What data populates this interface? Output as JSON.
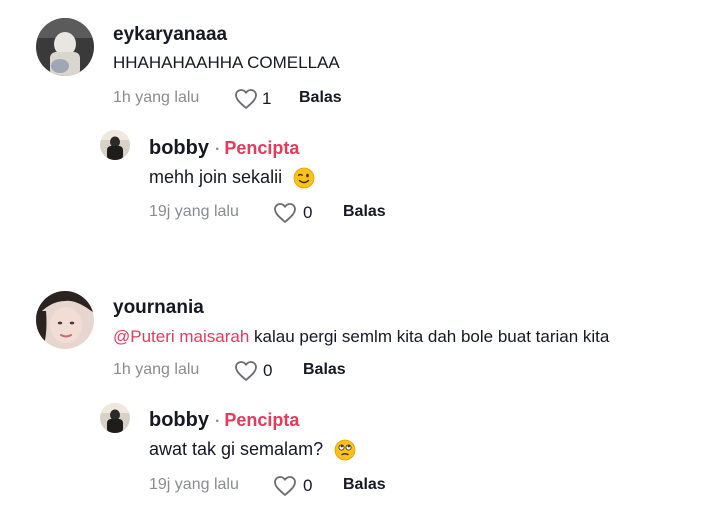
{
  "comments": [
    {
      "username": "eykaryanaaa",
      "text": "HHAHAHAAHHA COMELLAA",
      "time": "1h yang lalu",
      "likes": "1",
      "reply_label": "Balas",
      "reply": {
        "username": "bobby",
        "badge": "Pencipta",
        "text": "mehh join sekalii",
        "emoji": "winking-face-icon",
        "time": "19j yang lalu",
        "likes": "0",
        "reply_label": "Balas"
      }
    },
    {
      "username": "yournania",
      "mention": "@Puteri maisarah",
      "text": " kalau pergi semlm kita dah bole buat tarian kita",
      "time": "1h yang lalu",
      "likes": "0",
      "reply_label": "Balas",
      "reply": {
        "username": "bobby",
        "badge": "Pencipta",
        "text": "awat tak gi semalam?",
        "emoji": "face-with-rolling-eyes-icon",
        "time": "19j yang lalu",
        "likes": "0",
        "reply_label": "Balas"
      }
    }
  ],
  "colors": {
    "creator_badge": "#e8385c",
    "mention": "#e8385c",
    "meta_gray": "#8a8b91",
    "text": "#161823"
  }
}
